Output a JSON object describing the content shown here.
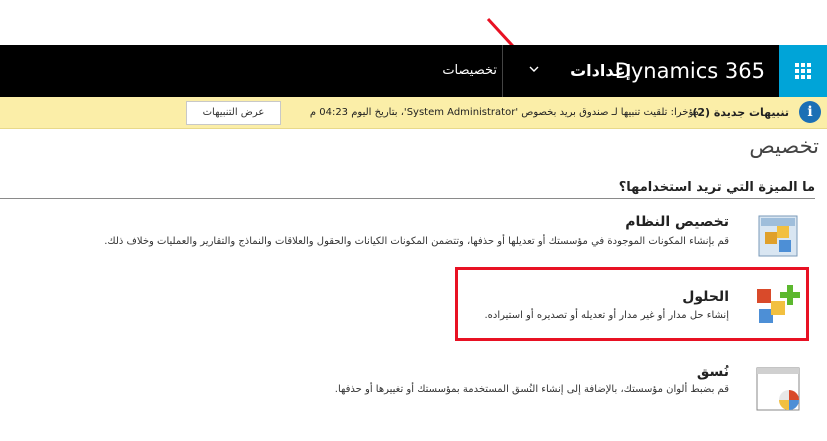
{
  "nav": {
    "brand": "Dynamics 365",
    "area": "إعدادات",
    "sub": "تخصيصات"
  },
  "notification": {
    "title": "تنبيهات جديدة (2)",
    "message": "مؤخرا: تلقيت تنبيها لـ صندوق بريد بخصوص 'System Administrator'، بتاريخ اليوم 04:23 م",
    "button": "عرض التنبيهات"
  },
  "page": {
    "title": "تخصيص",
    "question": "ما الميزة التي تريد استخدامها؟"
  },
  "items": [
    {
      "title": "تخصيص النظام",
      "desc": "قم بإنشاء المكونات الموجودة في مؤسستك أو تعديلها أو حذفها، وتتضمن المكونات الكيانات والحقول والعلاقات والنماذج والتقارير والعمليات وخلاف ذلك."
    },
    {
      "title": "الحلول",
      "desc": "إنشاء حل مدار أو غير مدار أو تعديله أو تصديره أو استيراده."
    },
    {
      "title": "نُسق",
      "desc": "قم بضبط ألوان مؤسستك، بالإضافة إلى إنشاء النُسق المستخدمة بمؤسستك أو تغييرها أو حذفها."
    }
  ],
  "colors": {
    "accent": "#00a4d8",
    "navbar": "#000000",
    "notification_bg": "#fbeea8",
    "highlight": "#e81123"
  },
  "icons": [
    "waffle-icon",
    "chevron-down-icon",
    "info-icon",
    "system-customization-icon",
    "solutions-icon",
    "themes-icon"
  ]
}
